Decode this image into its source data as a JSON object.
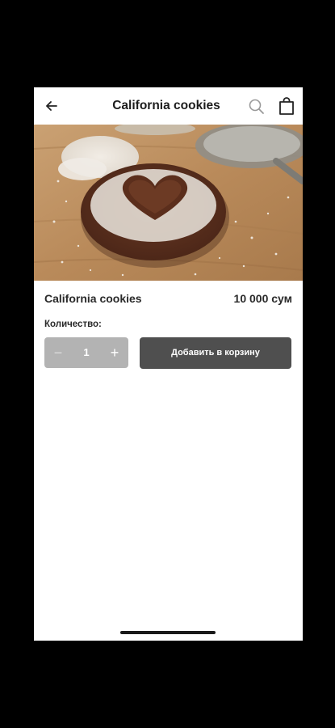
{
  "header": {
    "title": "California cookies",
    "back_icon": "arrow-left-icon",
    "search_icon": "search-icon",
    "cart_icon": "shopping-bag-icon"
  },
  "product": {
    "name": "California cookies",
    "price": "10 000 сум",
    "image_alt": "chocolate cookie with powdered sugar heart"
  },
  "quantity": {
    "label": "Количество:",
    "minus": "−",
    "value": "1",
    "plus": "+"
  },
  "actions": {
    "add_to_cart": "Добавить в корзину"
  },
  "colors": {
    "button_dark": "#4f4f4f",
    "stepper_bg": "#b3b3b3",
    "text": "#2a2a2a"
  }
}
